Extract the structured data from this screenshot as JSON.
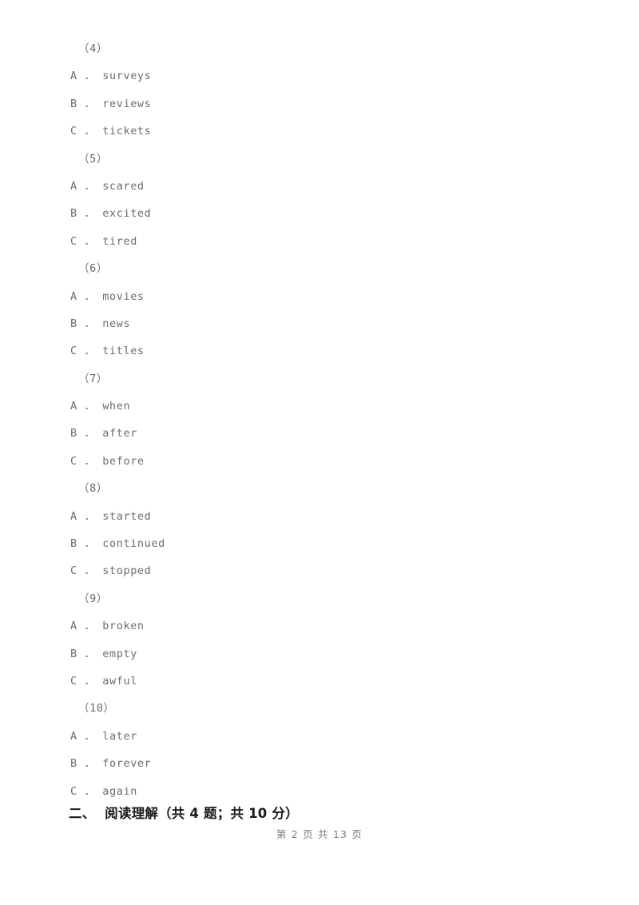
{
  "document": {
    "type": "scanned-exam-worksheet",
    "blocks": [
      {
        "kind": "question-number",
        "text": "（4）"
      },
      {
        "kind": "option",
        "text": "A ． surveys"
      },
      {
        "kind": "option",
        "text": "B ． reviews"
      },
      {
        "kind": "option",
        "text": "C ． tickets"
      },
      {
        "kind": "question-number",
        "text": "（5）"
      },
      {
        "kind": "option",
        "text": "A ． scared"
      },
      {
        "kind": "option",
        "text": "B ． excited"
      },
      {
        "kind": "option",
        "text": "C ． tired"
      },
      {
        "kind": "question-number",
        "text": "（6）"
      },
      {
        "kind": "option",
        "text": "A ． movies"
      },
      {
        "kind": "option",
        "text": "B ． news"
      },
      {
        "kind": "option",
        "text": "C ． titles"
      },
      {
        "kind": "question-number",
        "text": "（7）"
      },
      {
        "kind": "option",
        "text": "A ． when"
      },
      {
        "kind": "option",
        "text": "B ． after"
      },
      {
        "kind": "option",
        "text": "C ． before"
      },
      {
        "kind": "question-number",
        "text": "（8）"
      },
      {
        "kind": "option",
        "text": "A ． started"
      },
      {
        "kind": "option",
        "text": "B ． continued"
      },
      {
        "kind": "option",
        "text": "C ． stopped"
      },
      {
        "kind": "question-number",
        "text": "（9）"
      },
      {
        "kind": "option",
        "text": "A ． broken"
      },
      {
        "kind": "option",
        "text": "B ． empty"
      },
      {
        "kind": "option",
        "text": "C ． awful"
      },
      {
        "kind": "question-number",
        "text": "（10）"
      },
      {
        "kind": "option",
        "text": "A ． later"
      },
      {
        "kind": "option",
        "text": "B ． forever"
      },
      {
        "kind": "option",
        "text": "C ． again"
      }
    ],
    "section_heading": "二、  阅读理解（共 4 题；共 10 分）",
    "footer": "第 2 页 共 13 页"
  },
  "colors": {
    "page_background": "#ffffff",
    "body_text": "#6d6d6d",
    "heading_text": "#1a1a1a",
    "footer_text": "#7a7a7a"
  }
}
